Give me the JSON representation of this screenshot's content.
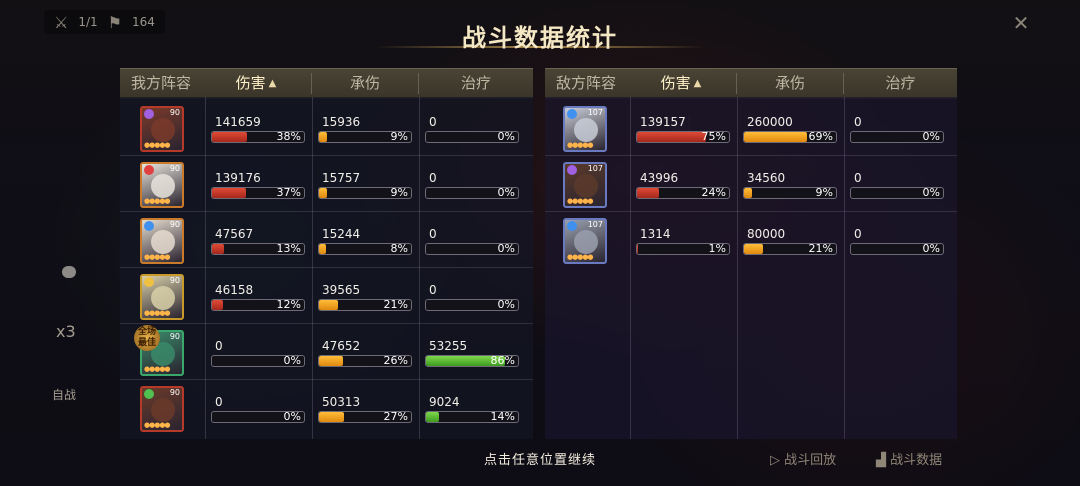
{
  "hud": {
    "wave": "1/1",
    "score": "164"
  },
  "title": "战斗数据统计",
  "headers": {
    "ally_label": "我方阵容",
    "enemy_label": "敌方阵容",
    "damage": "伤害",
    "taken": "承伤",
    "heal": "治疗",
    "sort_arrow": "▲"
  },
  "side": {
    "speed": "x3",
    "auto": "自战"
  },
  "allies": [
    {
      "level": "90",
      "damage": "141659",
      "damage_pct": "38%",
      "damage_frac": 0.38,
      "taken": "15936",
      "taken_pct": "9%",
      "taken_frac": 0.09,
      "heal": "0",
      "heal_pct": "0%",
      "heal_frac": 0
    },
    {
      "level": "90",
      "damage": "139176",
      "damage_pct": "37%",
      "damage_frac": 0.37,
      "taken": "15757",
      "taken_pct": "9%",
      "taken_frac": 0.09,
      "heal": "0",
      "heal_pct": "0%",
      "heal_frac": 0
    },
    {
      "level": "90",
      "damage": "47567",
      "damage_pct": "13%",
      "damage_frac": 0.13,
      "taken": "15244",
      "taken_pct": "8%",
      "taken_frac": 0.08,
      "heal": "0",
      "heal_pct": "0%",
      "heal_frac": 0
    },
    {
      "level": "90",
      "damage": "46158",
      "damage_pct": "12%",
      "damage_frac": 0.12,
      "taken": "39565",
      "taken_pct": "21%",
      "taken_frac": 0.21,
      "heal": "0",
      "heal_pct": "0%",
      "heal_frac": 0
    },
    {
      "level": "90",
      "damage": "0",
      "damage_pct": "0%",
      "damage_frac": 0,
      "taken": "47652",
      "taken_pct": "26%",
      "taken_frac": 0.26,
      "heal": "53255",
      "heal_pct": "86%",
      "heal_frac": 0.86,
      "badge": "全场最佳"
    },
    {
      "level": "90",
      "damage": "0",
      "damage_pct": "0%",
      "damage_frac": 0,
      "taken": "50313",
      "taken_pct": "27%",
      "taken_frac": 0.27,
      "heal": "9024",
      "heal_pct": "14%",
      "heal_frac": 0.14
    }
  ],
  "enemies": [
    {
      "level": "107",
      "damage": "139157",
      "damage_pct": "75%",
      "damage_frac": 0.75,
      "taken": "260000",
      "taken_pct": "69%",
      "taken_frac": 0.69,
      "heal": "0",
      "heal_pct": "0%",
      "heal_frac": 0
    },
    {
      "level": "107",
      "damage": "43996",
      "damage_pct": "24%",
      "damage_frac": 0.24,
      "taken": "34560",
      "taken_pct": "9%",
      "taken_frac": 0.09,
      "heal": "0",
      "heal_pct": "0%",
      "heal_frac": 0
    },
    {
      "level": "107",
      "damage": "1314",
      "damage_pct": "1%",
      "damage_frac": 0.01,
      "taken": "80000",
      "taken_pct": "21%",
      "taken_frac": 0.21,
      "heal": "0",
      "heal_pct": "0%",
      "heal_frac": 0
    }
  ],
  "footer": {
    "continue": "点击任意位置继续",
    "replay": "战斗回放",
    "battle_data": "战斗数据"
  },
  "colors": {
    "damage_bar": "#c8321f",
    "taken_bar": "#f0a020",
    "heal_bar": "#5cc43a"
  }
}
